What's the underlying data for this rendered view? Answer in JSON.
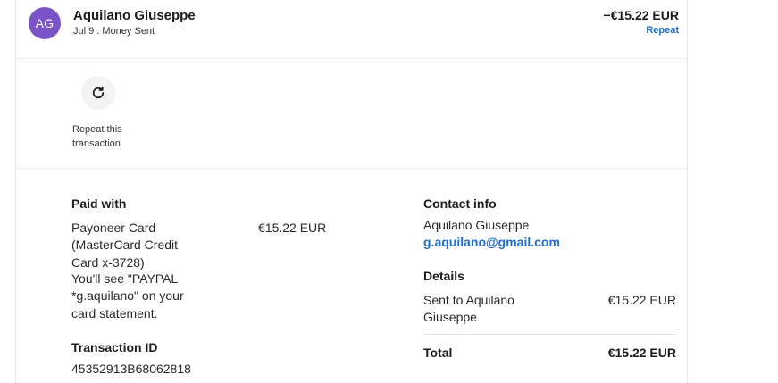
{
  "transaction": {
    "avatar_initials": "AG",
    "name": "Aquilano Giuseppe",
    "subline": "Jul 9 . Money Sent",
    "amount": "−€15.22 EUR",
    "repeat_link": "Repeat"
  },
  "repeat_action": {
    "icon": "refresh-icon",
    "caption": "Repeat this transaction"
  },
  "paid_with": {
    "title": "Paid with",
    "method": "Payoneer Card (MasterCard Credit Card x-3728)",
    "statement_note": "You'll see \"PAYPAL *g.aquilano\" on your card statement.",
    "amount": "€15.22 EUR"
  },
  "transaction_id": {
    "title": "Transaction ID",
    "value": "45352913B68062818"
  },
  "contact_info": {
    "title": "Contact info",
    "name": "Aquilano Giuseppe",
    "email": "g.aquilano@gmail.com"
  },
  "details": {
    "title": "Details",
    "description": "Sent to Aquilano Giuseppe",
    "amount": "€15.22 EUR",
    "total_label": "Total",
    "total_amount": "€15.22 EUR"
  },
  "colors": {
    "avatar_bg": "#7b53c9",
    "link": "#1f6fd1",
    "text": "#1c1c1c"
  }
}
